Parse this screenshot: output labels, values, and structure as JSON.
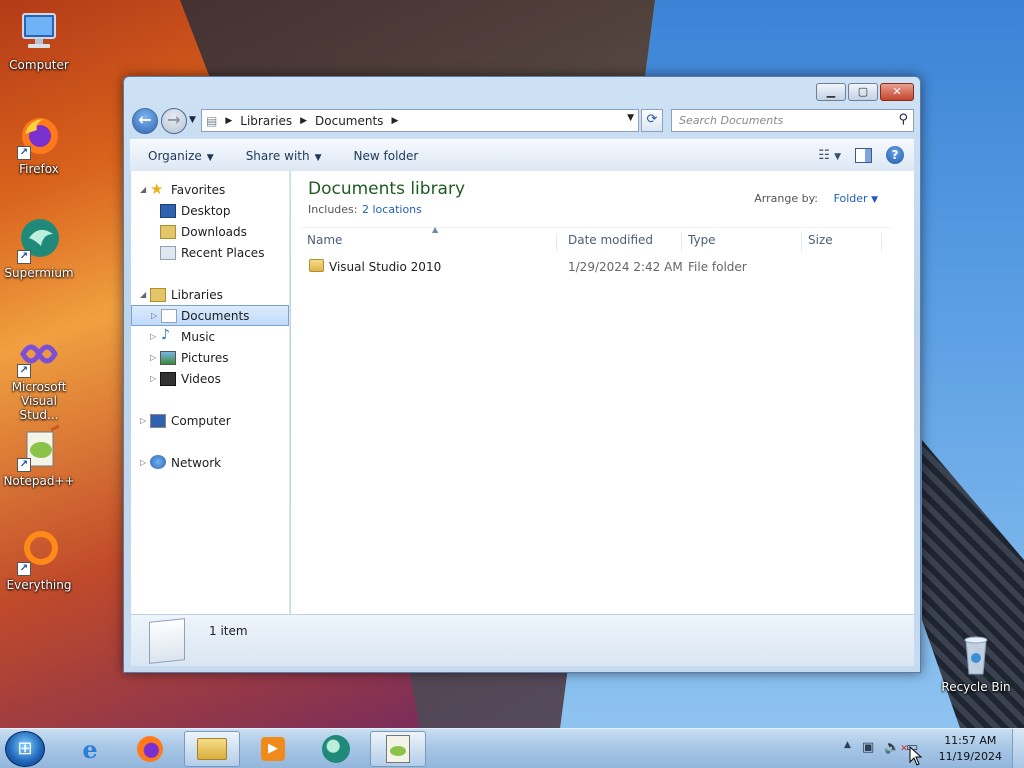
{
  "desktop": {
    "icons": [
      {
        "label": "Computer"
      },
      {
        "label": "Firefox"
      },
      {
        "label": "Supermium"
      },
      {
        "label": "Microsoft Visual Stud..."
      },
      {
        "label": "Notepad++"
      },
      {
        "label": "Everything"
      },
      {
        "label": "Recycle Bin"
      }
    ]
  },
  "window": {
    "address": {
      "segments": [
        "Libraries",
        "Documents"
      ]
    },
    "search": {
      "placeholder": "Search Documents"
    },
    "toolbar": {
      "organize": "Organize",
      "share_with": "Share with",
      "new_folder": "New folder"
    },
    "nav": {
      "favorites": "Favorites",
      "desktop": "Desktop",
      "downloads": "Downloads",
      "recent_places": "Recent Places",
      "libraries": "Libraries",
      "documents": "Documents",
      "music": "Music",
      "pictures": "Pictures",
      "videos": "Videos",
      "computer": "Computer",
      "network": "Network"
    },
    "content": {
      "title": "Documents library",
      "includes_label": "Includes:",
      "includes_link": "2 locations",
      "arrange_label": "Arrange by:",
      "arrange_value": "Folder",
      "columns": {
        "name": "Name",
        "date_modified": "Date modified",
        "type": "Type",
        "size": "Size"
      },
      "rows": [
        {
          "name": "Visual Studio 2010",
          "date_modified": "1/29/2024 2:42 AM",
          "type": "File folder",
          "size": ""
        }
      ]
    },
    "details": {
      "count": "1 item"
    }
  },
  "taskbar": {
    "clock_time": "11:57 AM",
    "clock_date": "11/19/2024"
  },
  "colors": {
    "library_title": "#1e5c1e",
    "link": "#1f5fbd",
    "selection": "#c1dbfc"
  }
}
